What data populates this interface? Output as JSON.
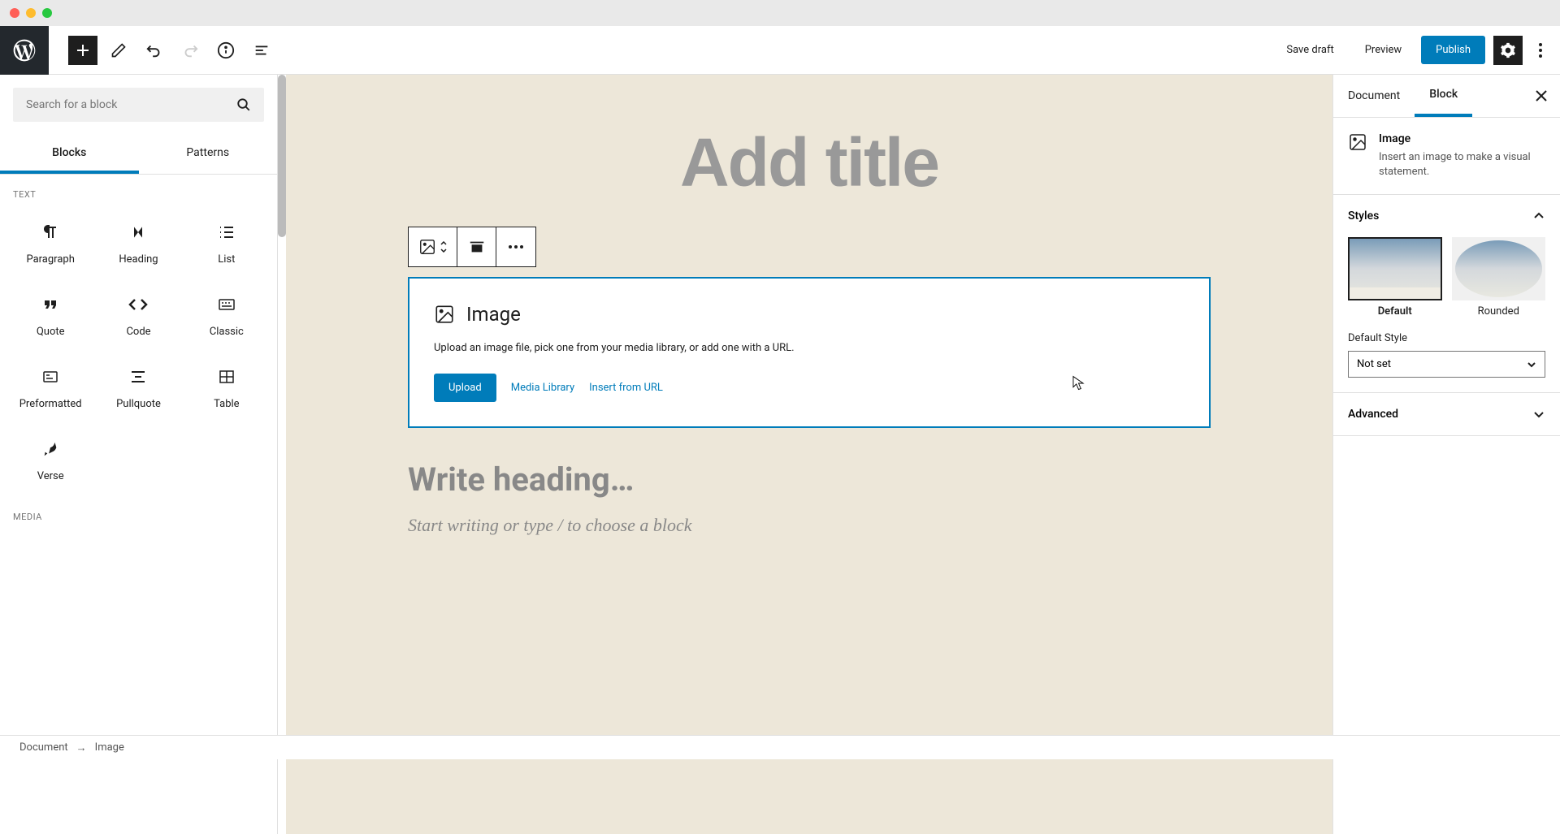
{
  "toolbar": {
    "save_draft": "Save draft",
    "preview": "Preview",
    "publish": "Publish"
  },
  "inserter": {
    "search_placeholder": "Search for a block",
    "tabs": {
      "blocks": "Blocks",
      "patterns": "Patterns"
    },
    "categories": {
      "text": "TEXT",
      "media": "MEDIA"
    },
    "blocks": {
      "paragraph": "Paragraph",
      "heading": "Heading",
      "list": "List",
      "quote": "Quote",
      "code": "Code",
      "classic": "Classic",
      "preformatted": "Preformatted",
      "pullquote": "Pullquote",
      "table": "Table",
      "verse": "Verse"
    }
  },
  "canvas": {
    "title_placeholder": "Add title",
    "image_block": {
      "title": "Image",
      "description": "Upload an image file, pick one from your media library, or add one with a URL.",
      "upload": "Upload",
      "media_library": "Media Library",
      "insert_url": "Insert from URL"
    },
    "heading_placeholder": "Write heading…",
    "paragraph_placeholder": "Start writing or type / to choose a block"
  },
  "sidebar": {
    "tabs": {
      "document": "Document",
      "block": "Block"
    },
    "block_info": {
      "title": "Image",
      "description": "Insert an image to make a visual statement."
    },
    "styles": {
      "header": "Styles",
      "default": "Default",
      "rounded": "Rounded",
      "default_style_label": "Default Style",
      "default_style_value": "Not set"
    },
    "advanced": "Advanced"
  },
  "breadcrumb": {
    "document": "Document",
    "current": "Image"
  }
}
